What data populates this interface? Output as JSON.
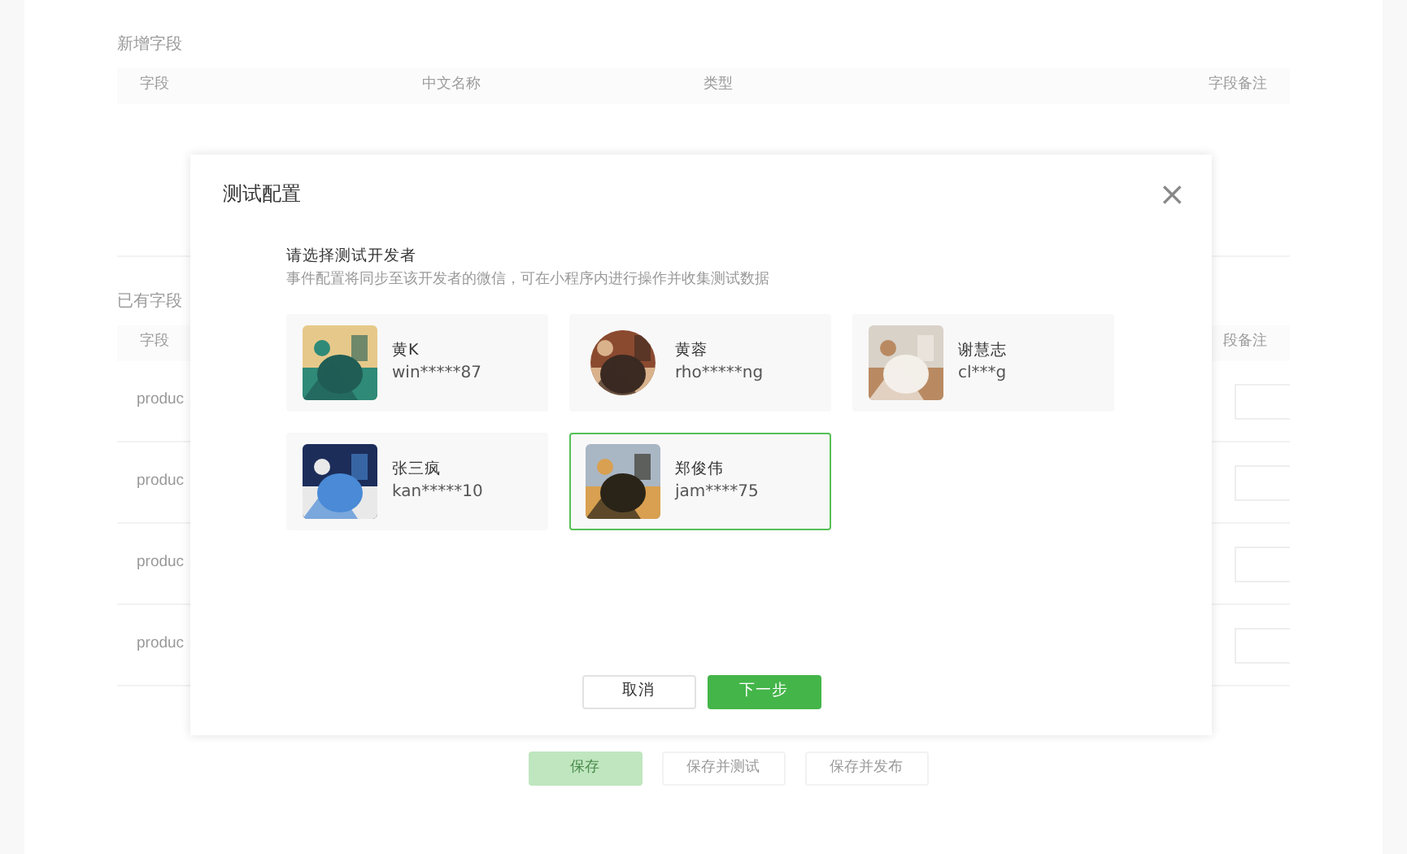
{
  "page": {
    "new_fields": {
      "title": "新增字段",
      "columns": [
        "字段",
        "中文名称",
        "类型",
        "字段备注"
      ]
    },
    "existing_fields": {
      "title": "已有字段",
      "columns": [
        "字段",
        "段备注"
      ],
      "rows": [
        {
          "field": "produc"
        },
        {
          "field": "produc"
        },
        {
          "field": "produc"
        },
        {
          "field": "produc"
        }
      ]
    },
    "buttons": [
      {
        "label": "保存",
        "kind": "primary",
        "disabled": true
      },
      {
        "label": "保存并测试",
        "kind": "default",
        "disabled": true
      },
      {
        "label": "保存并发布",
        "kind": "default",
        "disabled": true
      }
    ]
  },
  "dialog": {
    "title": "测试配置",
    "close": "×",
    "prompt": "请选择测试开发者",
    "description": "事件配置将同步至该开发者的微信，可在小程序内进行操作并收集测试数据",
    "developers": [
      {
        "name": "黄K",
        "account": "win*****87",
        "round_avatar": false,
        "selected": false
      },
      {
        "name": "黄蓉",
        "account": "rho*****ng",
        "round_avatar": true,
        "selected": false
      },
      {
        "name": "谢慧志",
        "account": "cl***g",
        "round_avatar": false,
        "selected": false
      },
      {
        "name": "张三疯",
        "account": "kan*****10",
        "round_avatar": false,
        "selected": false
      },
      {
        "name": "郑俊伟",
        "account": "jam****75",
        "round_avatar": false,
        "selected": true
      }
    ],
    "buttons": [
      {
        "label": "取消",
        "kind": "default"
      },
      {
        "label": "下一步",
        "kind": "primary"
      }
    ]
  }
}
